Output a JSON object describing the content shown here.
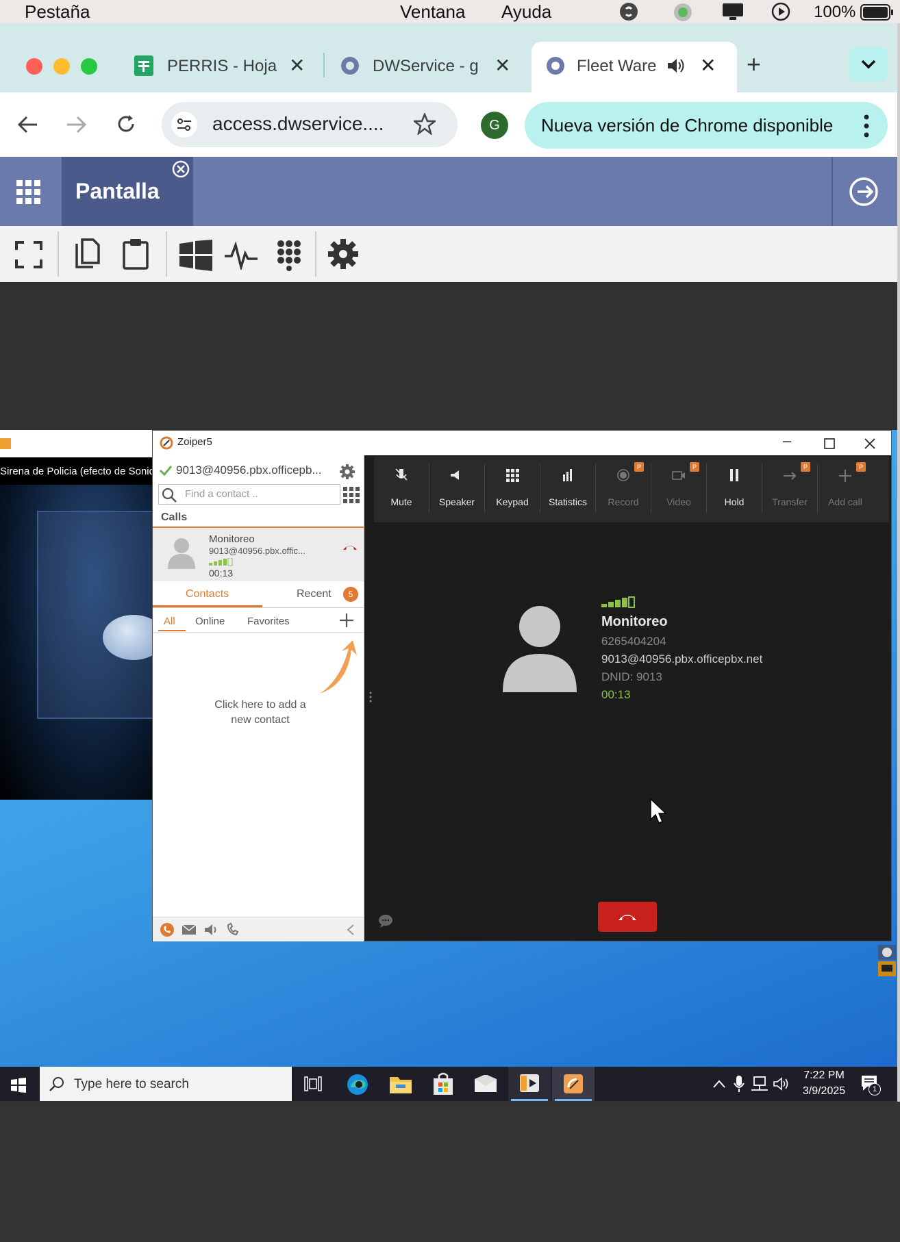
{
  "menubar": {
    "app_menu": "Pestaña",
    "window_menu": "Ventana",
    "help_menu": "Ayuda",
    "battery": "100%"
  },
  "browser": {
    "tabs": [
      {
        "title": "PERRIS - Hoja"
      },
      {
        "title": "DWService - g"
      },
      {
        "title": "Fleet Ware"
      }
    ],
    "address": "access.dwservice....",
    "profile_initial": "G",
    "update_notice": "Nueva versión de Chrome disponible"
  },
  "dws": {
    "tab_label": "Pantalla"
  },
  "media_window": {
    "title": "Sirena de Policia (efecto de Sonid"
  },
  "zoiper": {
    "window_title": "Zoiper5",
    "account": "9013@40956.pbx.officepb...",
    "search_placeholder": "Find a contact ..",
    "calls_heading": "Calls",
    "call_item": {
      "name": "Monitoreo",
      "account": "9013@40956.pbx.offic...",
      "duration": "00:13"
    },
    "tabs": {
      "contacts": "Contacts",
      "recent": "Recent",
      "recent_badge": "5"
    },
    "filters": {
      "all": "All",
      "online": "Online",
      "favorites": "Favorites"
    },
    "add_contact_hint_line1": "Click here to add a",
    "add_contact_hint_line2": "new contact",
    "controls": [
      {
        "label": "Mute",
        "icon": "mic-muted-icon",
        "enabled": true
      },
      {
        "label": "Speaker",
        "icon": "speaker-icon",
        "enabled": true
      },
      {
        "label": "Keypad",
        "icon": "keypad-icon",
        "enabled": true
      },
      {
        "label": "Statistics",
        "icon": "bars-icon",
        "enabled": true
      },
      {
        "label": "Record",
        "icon": "record-icon",
        "enabled": false,
        "badge": "P"
      },
      {
        "label": "Video",
        "icon": "video-icon",
        "enabled": false,
        "badge": "P"
      },
      {
        "label": "Hold",
        "icon": "pause-icon",
        "enabled": true
      },
      {
        "label": "Transfer",
        "icon": "transfer-icon",
        "enabled": false,
        "badge": "P"
      },
      {
        "label": "Add call",
        "icon": "plus-icon",
        "enabled": false,
        "badge": "P"
      }
    ],
    "caller": {
      "name": "Monitoreo",
      "number": "6265404204",
      "account": "9013@40956.pbx.officepbx.net",
      "dnid": "DNID: 9013",
      "duration": "00:13"
    }
  },
  "taskbar": {
    "search_placeholder": "Type here to search",
    "time": "7:22 PM",
    "date": "3/9/2025",
    "notification_count": "1"
  },
  "colors": {
    "chrome_tab_strip": "#d4eaea",
    "dws_header": "#6a7aaa",
    "zoiper_accent": "#e07a30",
    "zoiper_green": "#8bc34a",
    "hangup_red": "#c8201c"
  }
}
